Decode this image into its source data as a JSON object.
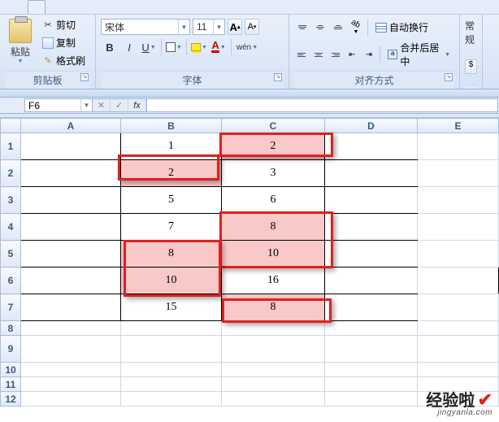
{
  "top_tab_remnant": "",
  "ribbon": {
    "clipboard": {
      "paste": "粘贴",
      "cut": "剪切",
      "copy": "复制",
      "format_painter": "格式刷",
      "group_label": "剪贴板"
    },
    "font": {
      "font_name": "宋体",
      "font_size": "11",
      "increase": "A",
      "decrease": "A",
      "bold": "B",
      "italic": "I",
      "underline": "U",
      "wen": "wén",
      "group_label": "字体"
    },
    "align": {
      "wrap": "自动换行",
      "merge": "合并后居中",
      "group_label": "对齐方式"
    },
    "number_partial": "常规"
  },
  "name_box": "F6",
  "fx_label": "fx",
  "columns": [
    "A",
    "B",
    "C",
    "D",
    "E"
  ],
  "rows": [
    "1",
    "2",
    "3",
    "4",
    "5",
    "6",
    "7",
    "8",
    "9",
    "10",
    "11",
    "12"
  ],
  "cells": {
    "B1": "1",
    "C1": "2",
    "B2": "2",
    "C2": "3",
    "B3": "5",
    "C3": "6",
    "B4": "7",
    "C4": "8",
    "B5": "8",
    "C5": "10",
    "B6": "10",
    "C6": "16",
    "B7": "15",
    "C7": "8"
  },
  "watermark": {
    "main": "经验啦",
    "check": "✔",
    "sub": "jingyanla.com"
  }
}
